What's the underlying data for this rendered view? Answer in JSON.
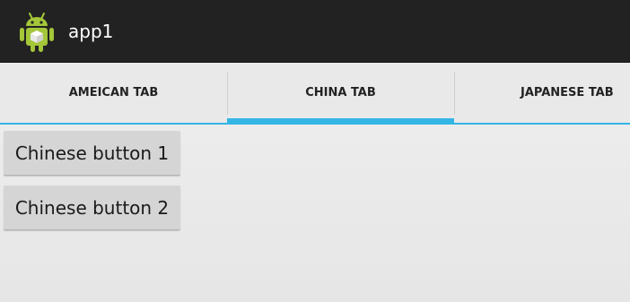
{
  "action_bar": {
    "app_icon": "android-robot-icon",
    "title": "app1",
    "background_color": "#222222"
  },
  "tabs": [
    {
      "label": "AMEICAN TAB",
      "selected": false
    },
    {
      "label": "CHINA TAB",
      "selected": true
    },
    {
      "label": "JAPANESE TAB",
      "selected": false
    }
  ],
  "accent_color": "#33b5e5",
  "content": {
    "buttons": [
      {
        "label": "Chinese button 1"
      },
      {
        "label": "Chinese button 2"
      }
    ]
  }
}
